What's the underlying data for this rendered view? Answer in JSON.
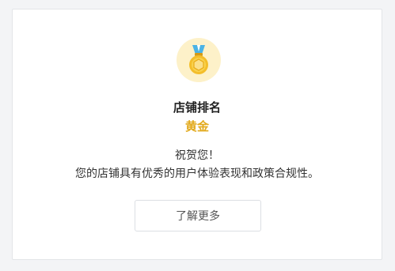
{
  "card": {
    "title": "店铺排名",
    "rank_label": "黄金",
    "congrats": "祝贺您！",
    "description": "您的店铺具有优秀的用户体验表现和政策合规性。",
    "learn_more_label": "了解更多"
  },
  "colors": {
    "gold": "#e2a91b",
    "medal_bg": "#fdf1c9",
    "ribbon": "#4bb3e6"
  },
  "icons": {
    "medal": "gold-medal-icon"
  }
}
